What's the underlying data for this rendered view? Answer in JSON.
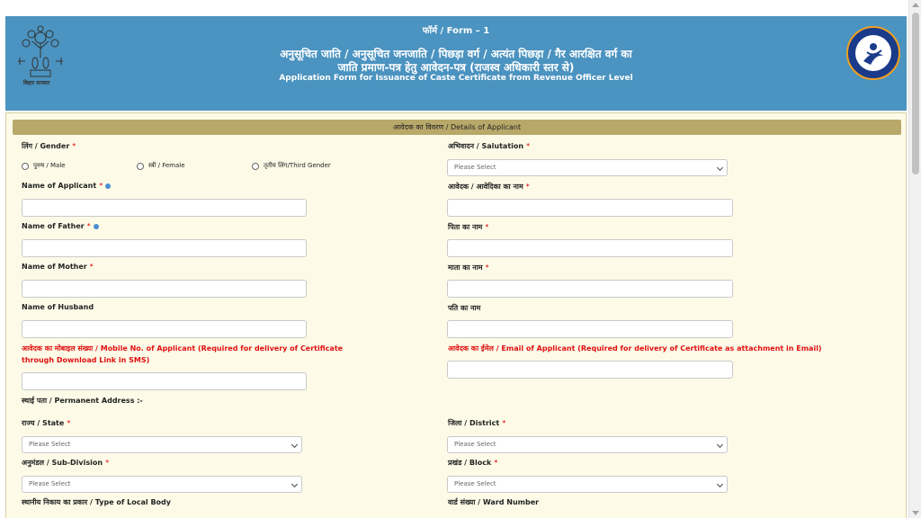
{
  "header": {
    "form_no": "फॉर्म / Form – 1",
    "title_hi_1": "अनुसूचित जाति / अनुसूचित जनजाति / पिछड़ा वर्ग / अत्यंत पिछड़ा / गैर आरक्षित वर्ग का",
    "title_hi_2": "जाति प्रमाण-पत्र हेतु आवेदन-पत्र (राजस्व अधिकारी स्तर से)",
    "title_en": "Application Form for Issuance of Caste Certificate from Revenue Officer Level",
    "emblem_caption": "बिहार सरकार"
  },
  "section": {
    "title": "आवेदक का विवरण / Details of Applicant"
  },
  "fields": {
    "gender": {
      "label": "लिंग / Gender",
      "options": [
        "पुरुष / Male",
        "स्त्री / Female",
        "तृतीय लिंग/Third Gender"
      ]
    },
    "salutation": {
      "label": "अभिवादन / Salutation",
      "value": "Please Select"
    },
    "name_applicant": {
      "label": "Name of Applicant"
    },
    "name_applicant_hi": {
      "label": "आवेदक / आवेदिका का नाम"
    },
    "name_father": {
      "label": "Name of Father"
    },
    "name_father_hi": {
      "label": "पिता का नाम"
    },
    "name_mother": {
      "label": "Name of Mother"
    },
    "name_mother_hi": {
      "label": "माता का नाम"
    },
    "name_husband": {
      "label": "Name of Husband"
    },
    "name_husband_hi": {
      "label": "पति का नाम"
    },
    "mobile": {
      "label": "आवेदक का मोबाइल संख्या / Mobile No. of Applicant (Required for delivery of Certificate through Download Link in SMS)"
    },
    "email": {
      "label": "आवेदक का ईमेल / Email of Applicant (Required for delivery of Certificate as attachment in Email)"
    },
    "permanent_address": {
      "label": "स्थाई पता / Permanent Address :-"
    },
    "state": {
      "label": "राज्य / State",
      "value": "Please Select"
    },
    "district": {
      "label": "जिला / District",
      "value": "Please Select"
    },
    "subdivision": {
      "label": "अनुमंडल / Sub-Division",
      "value": "Please Select"
    },
    "block": {
      "label": "प्रखंड / Block",
      "value": "Please Select"
    },
    "local_body": {
      "label": "स्थानीय निकाय का प्रकार / Type of Local Body"
    },
    "ward": {
      "label": "वार्ड संख्या / Ward Number"
    }
  },
  "required_mark": "*"
}
